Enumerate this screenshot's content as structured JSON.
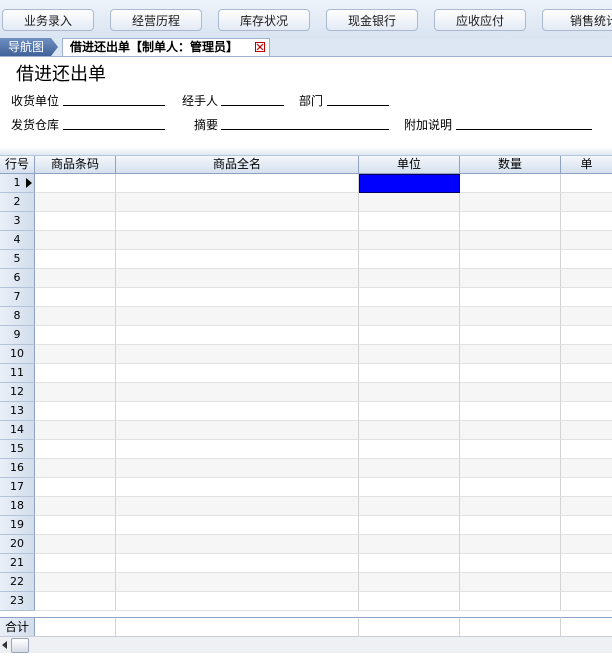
{
  "toolbar": {
    "buttons": [
      "业务录入",
      "经营历程",
      "库存状况",
      "现金银行",
      "应收应付",
      "销售统计"
    ]
  },
  "tabs": {
    "nav_label": "导航图",
    "document_label": "借进还出单【制单人：管理员】"
  },
  "form": {
    "title": "借进还出单",
    "receiving_unit_label": "收货单位",
    "handler_label": "经手人",
    "department_label": "部门",
    "shipping_warehouse_label": "发货仓库",
    "summary_label": "摘要",
    "additional_notes_label": "附加说明"
  },
  "grid": {
    "columns": [
      "行号",
      "商品条码",
      "商品全名",
      "单位",
      "数量",
      "单"
    ],
    "rows": [
      "1",
      "2",
      "3",
      "4",
      "5",
      "6",
      "7",
      "8",
      "9",
      "10",
      "11",
      "12",
      "13",
      "14",
      "15",
      "16",
      "17",
      "18",
      "19",
      "20",
      "21",
      "22",
      "23"
    ],
    "current_row": 1,
    "selected_column": "单位",
    "total_label": "合计"
  },
  "colors": {
    "selection": "#0000ff",
    "nav_tab": "#4a6da3",
    "header_bg": "#d5e0ee"
  },
  "icons": {
    "tab_close": "close-box-icon",
    "row_indicator": "triangle-right-icon",
    "scroll_left": "chevron-left-icon"
  }
}
